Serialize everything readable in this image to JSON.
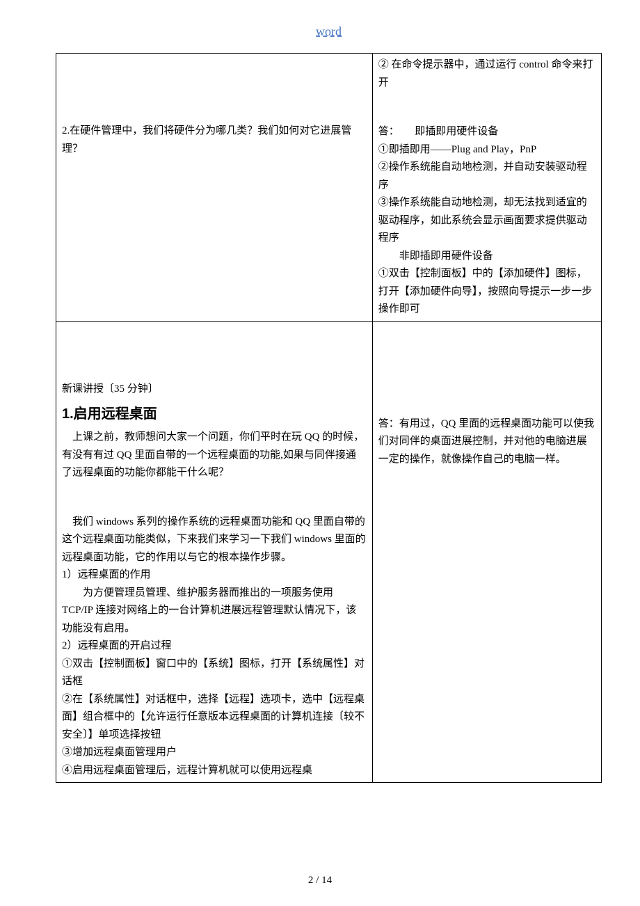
{
  "header": {
    "link": "word"
  },
  "row1": {
    "left": {
      "q2": "2.在硬件管理中，我们将硬件分为哪几类？我们如何对它进展管理？"
    },
    "right": {
      "line1": "② 在命令提示器中，通过运行 control 命令来打开",
      "ans_label": "答：",
      "ans_title": "即插即用硬件设备",
      "a1": "①即插即用——Plug and Play，PnP",
      "a2": "②操作系统能自动地检测，并自动安装驱动程序",
      "a3": "③操作系统能自动地检测，却无法找到适宜的驱动程序，如此系统会显示画面要求提供驱动程序",
      "sub2": "　　非即插即用硬件设备",
      "b1": "①双击【控制面板】中的【添加硬件】图标，打开【添加硬件向导】，按照向导提示一步一步操作即可"
    }
  },
  "row2": {
    "left": {
      "section_label": "新课讲授〔35 分钟〕",
      "h1": "1.启用远程桌面",
      "p1": "　上课之前，教师想问大家一个问题，你们平时在玩 QQ 的时候，有没有有过 QQ 里面自带的一个远程桌面的功能,如果与同伴接通了远程桌面的功能你都能干什么呢？",
      "p2": "　我们 windows 系列的操作系统的远程桌面功能和 QQ 里面自带的这个远程桌面功能类似，下来我们来学习一下我们 windows 里面的远程桌面功能，它的作用以与它的根本操作步骤。",
      "l1": "1）远程桌面的作用",
      "l1a": "　　为方便管理员管理、维护服务器而推出的一项服务使用 TCP/IP 连接对网络上的一台计算机进展远程管理默认情况下，该功能没有启用。",
      "l2": "2）远程桌面的开启过程",
      "s1": "①双击【控制面板】窗口中的【系统】图标，打开【系统属性】对话框",
      "s2": "②在【系统属性】对话框中，选择【远程】选项卡，选中【远程桌面】组合框中的【允许运行任意版本远程桌面的计算机连接〔较不安全〕】单项选择按钮",
      "s3": "③增加远程桌面管理用户",
      "s4": "④启用远程桌面管理后，远程计算机就可以使用远程桌"
    },
    "right": {
      "ans": "答：有用过，QQ 里面的远程桌面功能可以使我们对同伴的桌面进展控制，并对他的电脑进展一定的操作，就像操作自己的电脑一样。"
    }
  },
  "footer": {
    "page": "2 / 14"
  }
}
